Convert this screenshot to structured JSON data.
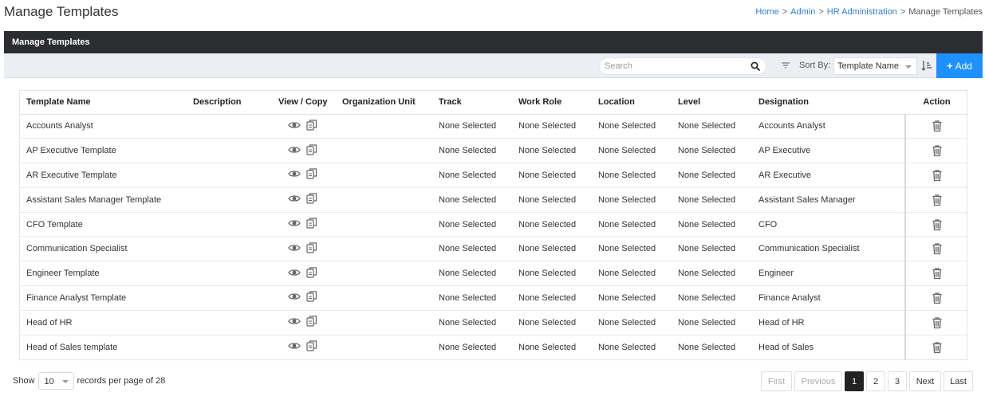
{
  "page": {
    "title": "Manage Templates"
  },
  "breadcrumb": {
    "items": [
      "Home",
      "Admin",
      "HR Administration"
    ],
    "current": "Manage Templates",
    "separator": ">"
  },
  "panel": {
    "title": "Manage Templates"
  },
  "toolbar": {
    "search_placeholder": "Search",
    "sort_label": "Sort By:",
    "sort_value": "Template Name",
    "add_label": "Add",
    "add_color": "#1e90ff"
  },
  "table": {
    "headers": [
      "Template Name",
      "Description",
      "View / Copy",
      "Organization Unit",
      "Track",
      "Work Role",
      "Location",
      "Level",
      "Designation",
      "Action"
    ],
    "rows": [
      {
        "name": "Accounts Analyst",
        "description": "",
        "org_unit": "",
        "track": "None Selected",
        "work_role": "None Selected",
        "location": "None Selected",
        "level": "None Selected",
        "designation": "Accounts Analyst"
      },
      {
        "name": "AP Executive Template",
        "description": "",
        "org_unit": "",
        "track": "None Selected",
        "work_role": "None Selected",
        "location": "None Selected",
        "level": "None Selected",
        "designation": "AP Executive"
      },
      {
        "name": "AR Executive Template",
        "description": "",
        "org_unit": "",
        "track": "None Selected",
        "work_role": "None Selected",
        "location": "None Selected",
        "level": "None Selected",
        "designation": "AR Executive"
      },
      {
        "name": "Assistant Sales Manager Template",
        "description": "",
        "org_unit": "",
        "track": "None Selected",
        "work_role": "None Selected",
        "location": "None Selected",
        "level": "None Selected",
        "designation": "Assistant Sales Manager"
      },
      {
        "name": "CFO Template",
        "description": "",
        "org_unit": "",
        "track": "None Selected",
        "work_role": "None Selected",
        "location": "None Selected",
        "level": "None Selected",
        "designation": "CFO"
      },
      {
        "name": "Communication Specialist",
        "description": "",
        "org_unit": "",
        "track": "None Selected",
        "work_role": "None Selected",
        "location": "None Selected",
        "level": "None Selected",
        "designation": "Communication Specialist"
      },
      {
        "name": "Engineer Template",
        "description": "",
        "org_unit": "",
        "track": "None Selected",
        "work_role": "None Selected",
        "location": "None Selected",
        "level": "None Selected",
        "designation": "Engineer"
      },
      {
        "name": "Finance Analyst Template",
        "description": "",
        "org_unit": "",
        "track": "None Selected",
        "work_role": "None Selected",
        "location": "None Selected",
        "level": "None Selected",
        "designation": "Finance Analyst"
      },
      {
        "name": "Head of HR",
        "description": "",
        "org_unit": "",
        "track": "None Selected",
        "work_role": "None Selected",
        "location": "None Selected",
        "level": "None Selected",
        "designation": "Head of HR"
      },
      {
        "name": "Head of Sales template",
        "description": "",
        "org_unit": "",
        "track": "None Selected",
        "work_role": "None Selected",
        "location": "None Selected",
        "level": "None Selected",
        "designation": "Head of Sales"
      }
    ],
    "icons": {
      "view": "eye-icon",
      "copy": "copy-icon",
      "delete": "trash-icon"
    }
  },
  "footer": {
    "show_label": "Show",
    "page_size": "10",
    "records_text": "records per page of 28"
  },
  "pagination": {
    "first": "First",
    "previous": "Previous",
    "pages": [
      "1",
      "2",
      "3"
    ],
    "active_page": "1",
    "next": "Next",
    "last": "Last"
  }
}
